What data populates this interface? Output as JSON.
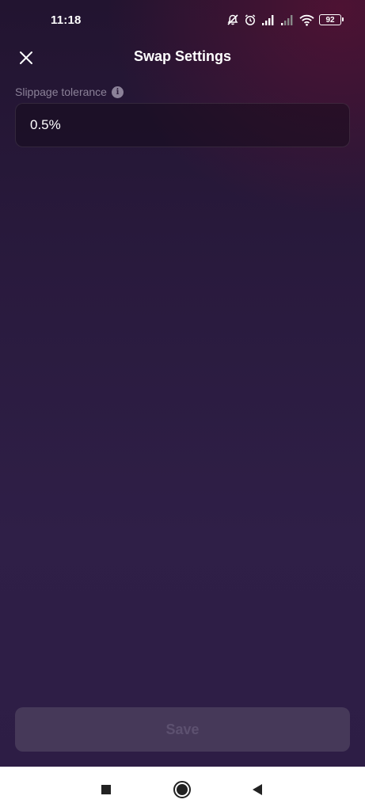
{
  "status_bar": {
    "time": "11:18",
    "battery_level": "92",
    "icons": [
      "notifications-off-icon",
      "alarm-icon",
      "signal-icon",
      "signal-weak-icon",
      "wifi-icon",
      "battery-icon"
    ]
  },
  "header": {
    "title": "Swap Settings",
    "close_icon": "close-icon"
  },
  "slippage": {
    "label": "Slippage tolerance",
    "info_icon": "info-icon",
    "value": "0.5%"
  },
  "footer": {
    "save_label": "Save"
  },
  "nav_bar": {
    "icons": [
      "recent-apps-icon",
      "home-icon",
      "back-icon"
    ]
  },
  "colors": {
    "background_top": "#221430",
    "background_bottom": "#2d1d45",
    "accent_glow": "#5c1234",
    "text_primary": "#ffffff",
    "text_muted": "#8b8198",
    "save_button_bg": "#463959",
    "save_button_text": "#5d5170"
  }
}
